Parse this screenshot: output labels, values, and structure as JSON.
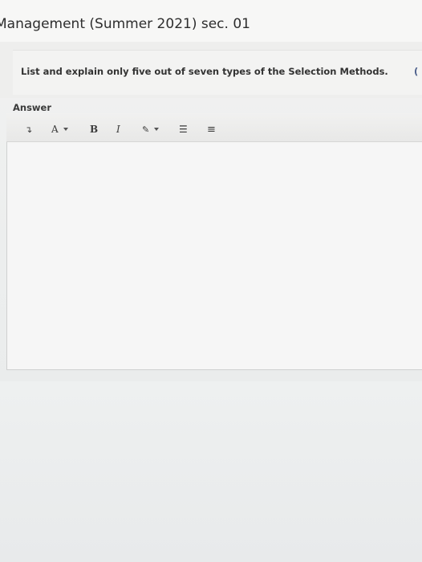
{
  "header": {
    "title": "Management (Summer 2021) sec. 01"
  },
  "question": {
    "text": "List and explain only five out of seven types of the Selection Methods.",
    "overflow_marker": "("
  },
  "answer": {
    "label": "Answer",
    "value": ""
  },
  "toolbar": {
    "items": [
      {
        "name": "paragraph-style",
        "glyph": "↴"
      },
      {
        "name": "font-color",
        "glyph": "A"
      },
      {
        "name": "bold",
        "glyph": "B"
      },
      {
        "name": "italic",
        "glyph": "I"
      },
      {
        "name": "highlight",
        "glyph": "✎"
      },
      {
        "name": "bullet-list",
        "glyph": "☰"
      },
      {
        "name": "numbered-list",
        "glyph": "≡"
      }
    ]
  }
}
